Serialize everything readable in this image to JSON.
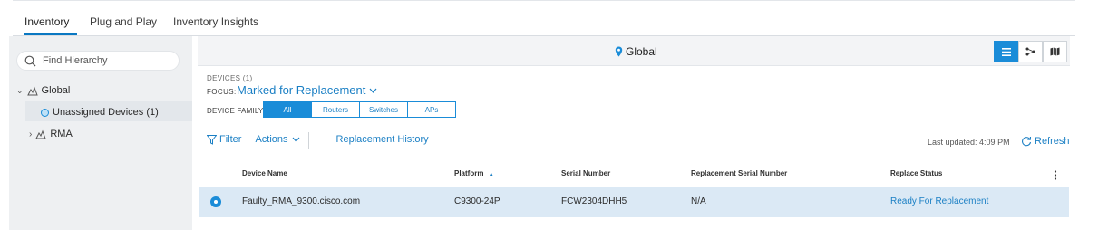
{
  "tabs": [
    {
      "label": "Inventory",
      "active": true
    },
    {
      "label": "Plug and Play",
      "active": false
    },
    {
      "label": "Inventory Insights",
      "active": false
    }
  ],
  "hierarchy": {
    "search_placeholder": "Find Hierarchy",
    "items": [
      {
        "label": "Global",
        "icon": "site-icon",
        "expanded": true
      },
      {
        "label": "Unassigned Devices (1)",
        "icon": "status-dot-icon",
        "selected": true
      },
      {
        "label": "RMA",
        "icon": "site-icon",
        "expanded": false
      }
    ]
  },
  "topbar": {
    "location": "Global",
    "view_modes": [
      "list-view",
      "topology-view",
      "map-view"
    ],
    "active_view": "list-view"
  },
  "devices": {
    "count_label": "DEVICES (1)",
    "focus_label": "FOCUS:",
    "focus_value": "Marked for Replacement",
    "family_label": "DEVICE FAMILY",
    "families": [
      "All",
      "Routers",
      "Switches",
      "APs"
    ],
    "selected_family": "All"
  },
  "toolbar": {
    "filter_label": "Filter",
    "actions_label": "Actions",
    "history_label": "Replacement History",
    "last_updated": "Last updated: 4:09 PM",
    "refresh_label": "Refresh"
  },
  "table": {
    "columns": [
      "Device Name",
      "Platform",
      "Serial Number",
      "Replacement Serial Number",
      "Replace Status"
    ],
    "sort_indicator": "▲",
    "rows": [
      {
        "device_name": "Faulty_RMA_9300.cisco.com",
        "platform": "C9300-24P",
        "serial_number": "FCW2304DHH5",
        "replacement_serial": "N/A",
        "replace_status": "Ready For Replacement"
      }
    ]
  },
  "colors": {
    "accent": "#1a8cd8",
    "row_selected": "#dbe9f5",
    "link": "#1a7fc4"
  }
}
